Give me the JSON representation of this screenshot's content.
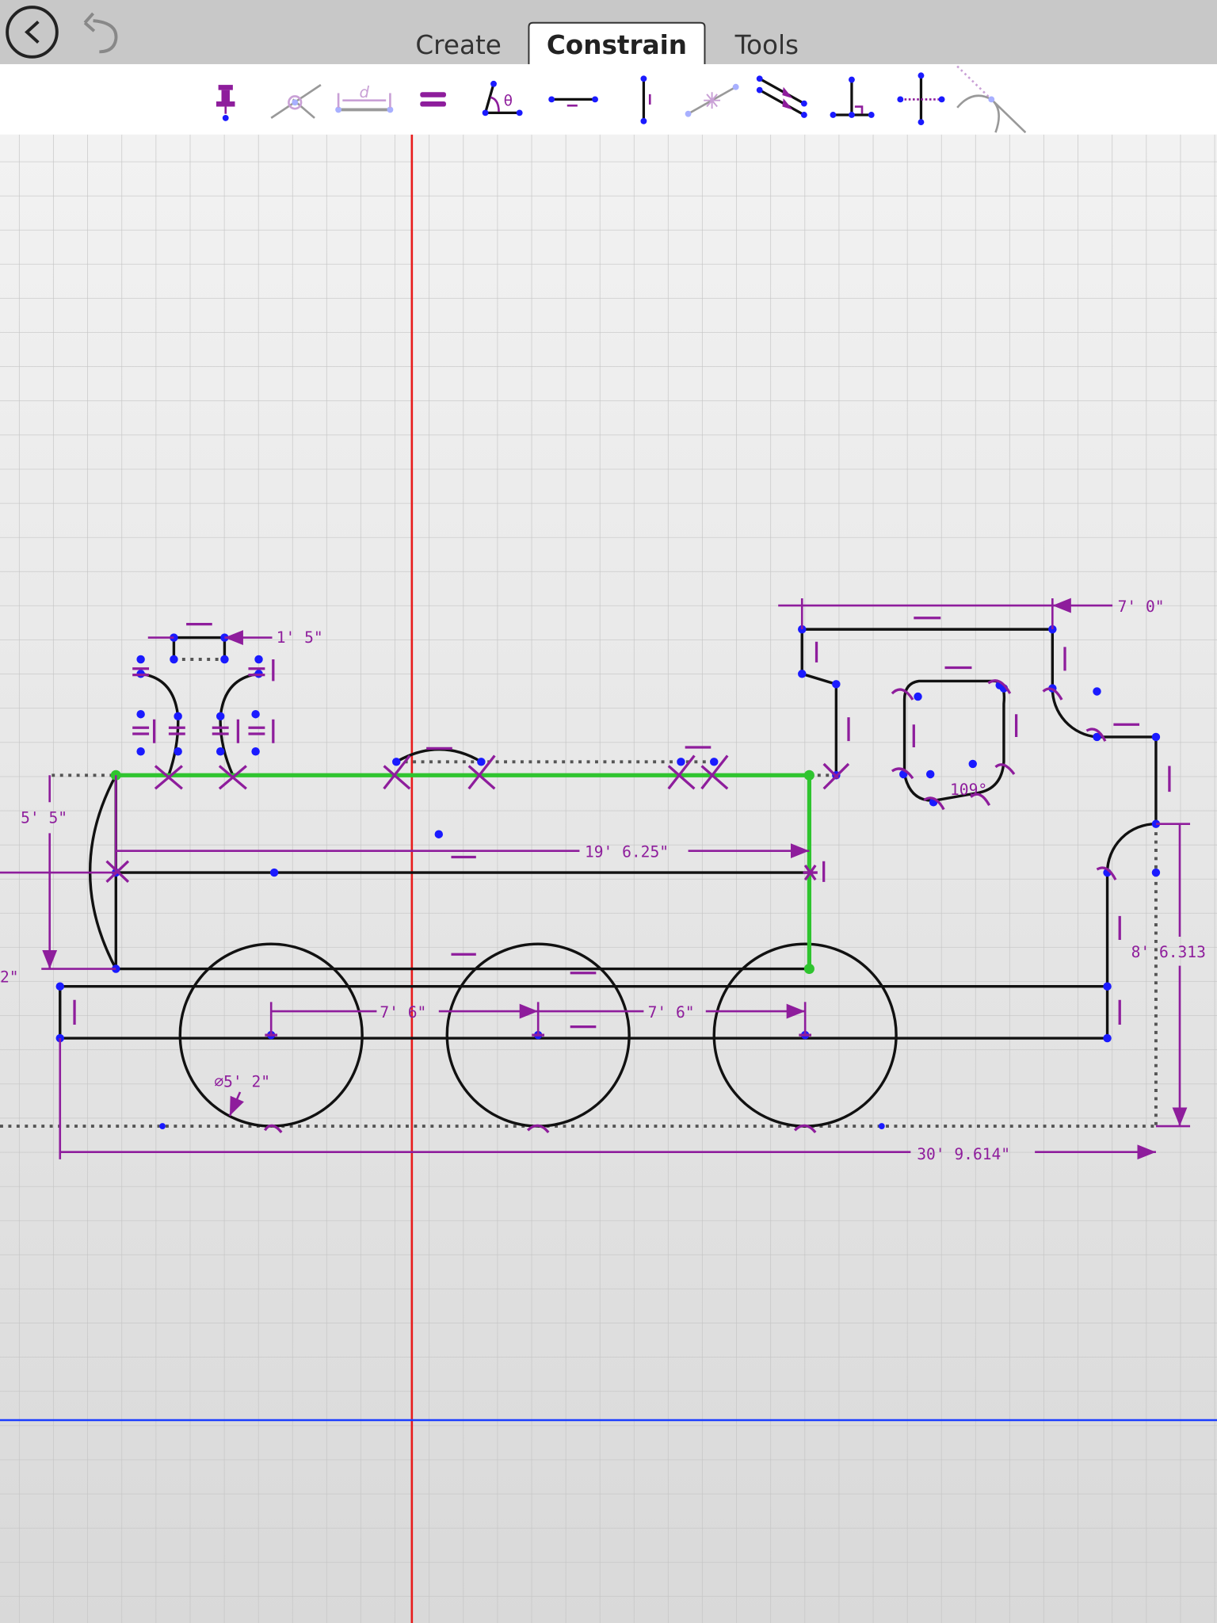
{
  "header": {
    "tabs": [
      {
        "label": "Create",
        "active": false
      },
      {
        "label": "Constrain",
        "active": true
      },
      {
        "label": "Tools",
        "active": false
      }
    ],
    "back_icon": "chevron-left-circle-icon",
    "undo_icon": "undo-arrow-icon"
  },
  "toolbar": {
    "tools": [
      {
        "name": "fix-pin",
        "icon": "pushpin-icon"
      },
      {
        "name": "coincident",
        "icon": "coincident-icon"
      },
      {
        "name": "distance",
        "icon": "distance-icon",
        "label": "d"
      },
      {
        "name": "equal",
        "icon": "equal-icon"
      },
      {
        "name": "angle",
        "icon": "angle-icon",
        "label": "θ"
      },
      {
        "name": "horizontal",
        "icon": "horizontal-icon"
      },
      {
        "name": "vertical",
        "icon": "vertical-icon"
      },
      {
        "name": "midpoint",
        "icon": "midpoint-icon"
      },
      {
        "name": "parallel",
        "icon": "parallel-icon"
      },
      {
        "name": "perpendicular",
        "icon": "perpendicular-icon"
      },
      {
        "name": "symmetric",
        "icon": "symmetric-icon"
      },
      {
        "name": "tangent",
        "icon": "tangent-icon"
      }
    ]
  },
  "canvas": {
    "colors": {
      "dimension": "#8e1d9c",
      "point": "#1a1aff",
      "selection": "#2fc42f",
      "x_axis": "#1a3cff",
      "y_axis": "#e81c1c"
    },
    "dimensions": {
      "cab_width": "7' 0\"",
      "chimney_width": "1' 5\"",
      "boiler_height": "5' 5\"",
      "boiler_length": "19' 6.25\"",
      "wheel_spacing_1": "7' 6\"",
      "wheel_spacing_2": "7' 6\"",
      "wheel_diameter": "⌀5' 2\"",
      "total_length": "30' 9.614\"",
      "total_height": "8' 6.313",
      "partial_left": "2\"",
      "window_angle": "109°"
    }
  }
}
